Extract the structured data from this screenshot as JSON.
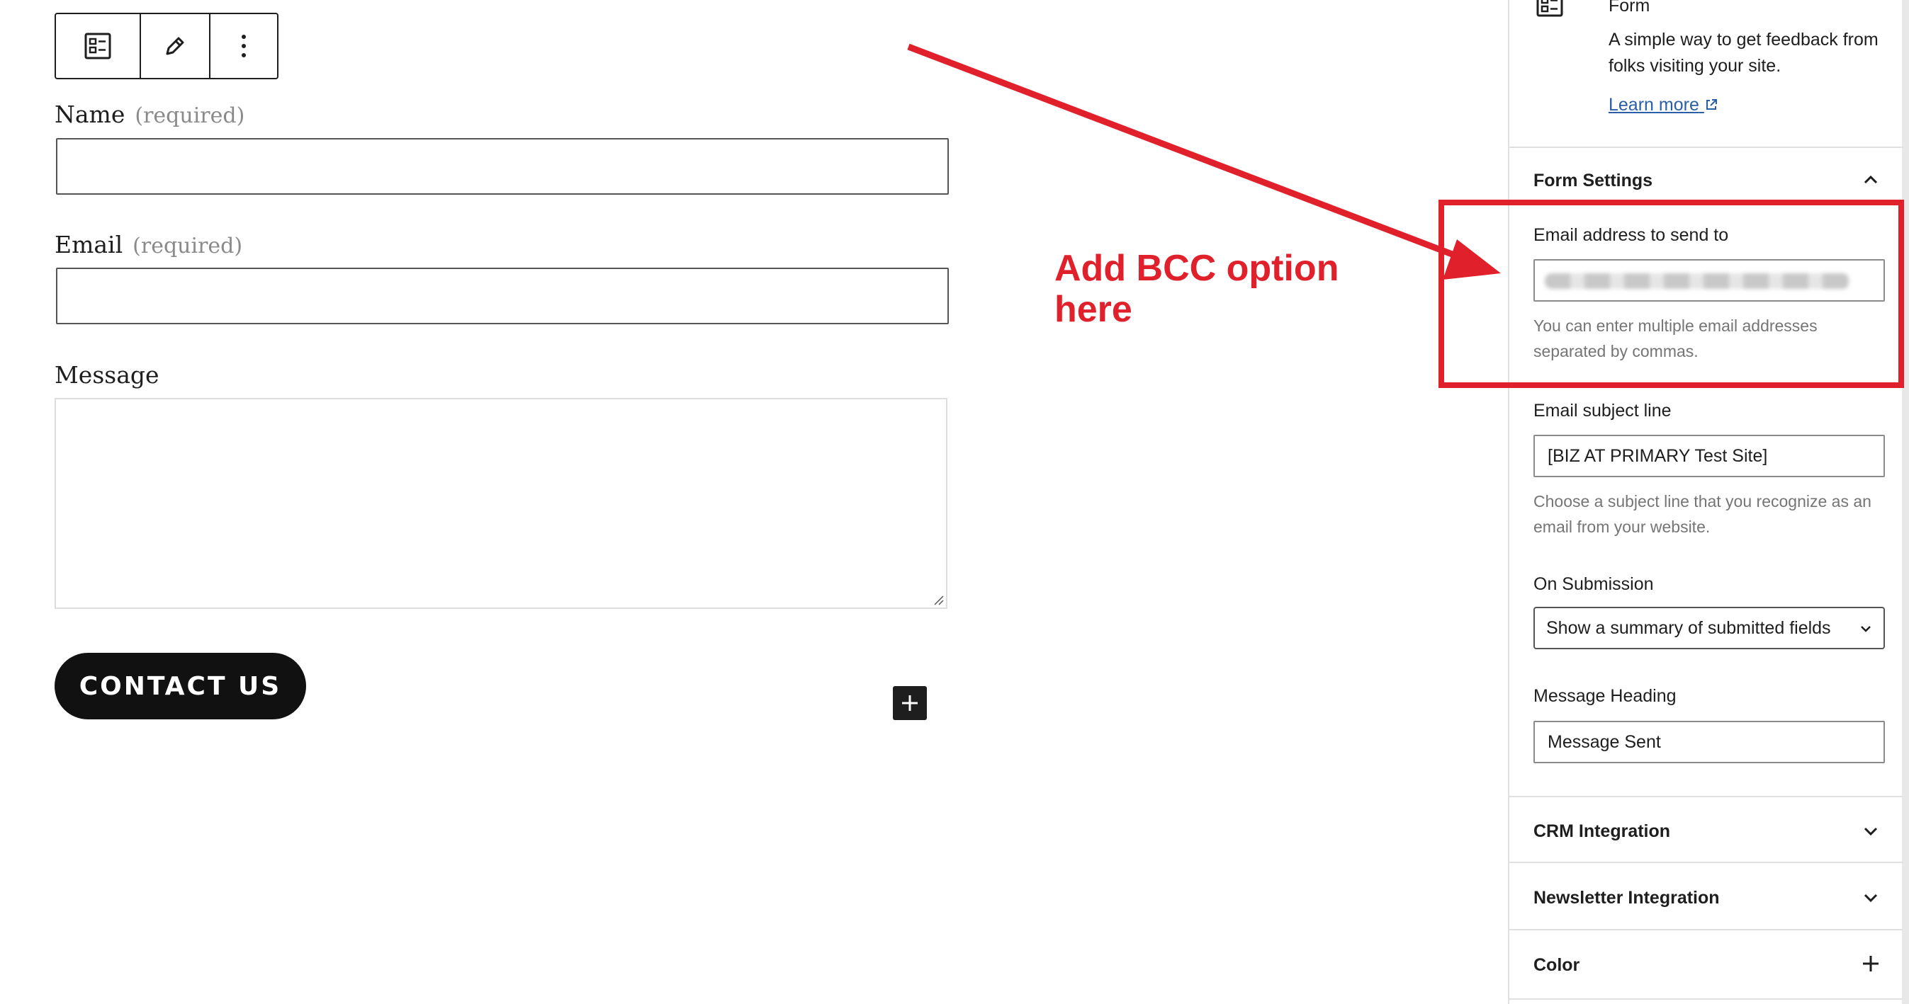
{
  "editor": {
    "toolbar": {
      "block_type_icon": "form-icon",
      "edit_icon": "pencil-icon",
      "options_icon": "more-vertical-icon"
    },
    "fields": [
      {
        "label": "Name",
        "required": "(required)"
      },
      {
        "label": "Email",
        "required": "(required)"
      },
      {
        "label": "Message"
      }
    ],
    "submit_button": "CONTACT US",
    "add_block_icon": "plus-icon"
  },
  "annotation": {
    "text": "Add BCC option here",
    "color": "#e0202b"
  },
  "sidebar": {
    "block": {
      "icon": "form-icon",
      "title": "Form",
      "description": "A simple way to get feedback from folks visiting your site.",
      "learn_more": "Learn more",
      "external_icon": "external-link-icon"
    },
    "form_settings": {
      "title": "Form Settings",
      "email_label": "Email address to send to",
      "email_help": "You can enter multiple email addresses separated by commas.",
      "subject_label": "Email subject line",
      "subject_value": "[BIZ AT PRIMARY Test Site]",
      "subject_help": "Choose a subject line that you recognize as an email from your website.",
      "submission_label": "On Submission",
      "submission_value": "Show a summary of submitted fields",
      "heading_label": "Message Heading",
      "heading_value": "Message Sent"
    },
    "panels": [
      {
        "title": "CRM Integration",
        "icon": "chevron-down-icon"
      },
      {
        "title": "Newsletter Integration",
        "icon": "chevron-down-icon"
      },
      {
        "title": "Color",
        "icon": "plus-icon"
      }
    ]
  }
}
